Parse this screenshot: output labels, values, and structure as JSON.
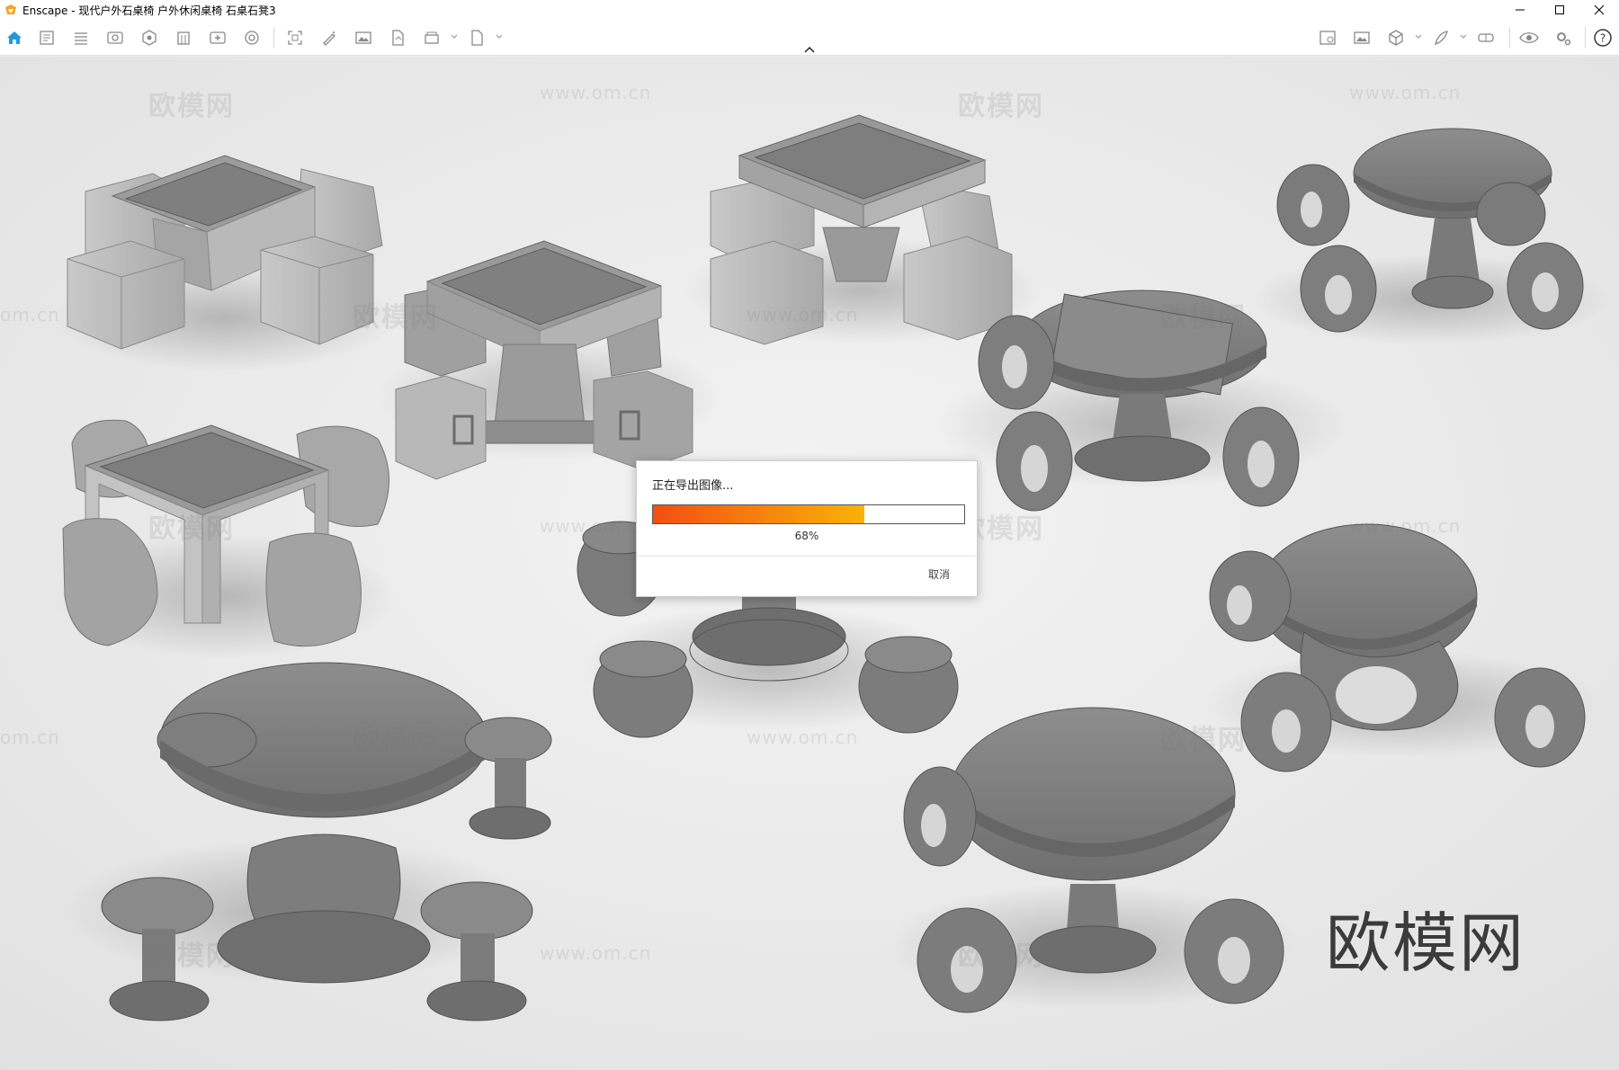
{
  "window": {
    "title": "Enscape - 现代户外石桌椅 户外休闲桌椅 石桌石凳3",
    "accent_color": "#f5a623"
  },
  "toolbar": {
    "left_icons": [
      "home-icon",
      "asset-library-icon",
      "settings-list-icon",
      "view-icon",
      "material-icon",
      "building-icon",
      "add-view-icon",
      "render-icon",
      "screenshot-icon",
      "edit-icon",
      "image-icon",
      "export-icon",
      "batch-icon",
      "file-export-icon"
    ],
    "right_icons": [
      "visual-settings-icon",
      "image-icon",
      "cube-icon",
      "feather-icon",
      "vr-icon",
      "eye-icon",
      "gear-icon",
      "help-icon"
    ]
  },
  "watermarks": {
    "logo_text": "欧模网",
    "url_text": "www.om.cn",
    "url_fragment": "om.cn"
  },
  "brand_mark": "欧模网",
  "export_dialog": {
    "title": "正在导出图像...",
    "progress": 0.68,
    "progress_label": "68%",
    "cancel_label": "取消",
    "progress_colors": [
      "#f24f12",
      "#fab208"
    ]
  }
}
